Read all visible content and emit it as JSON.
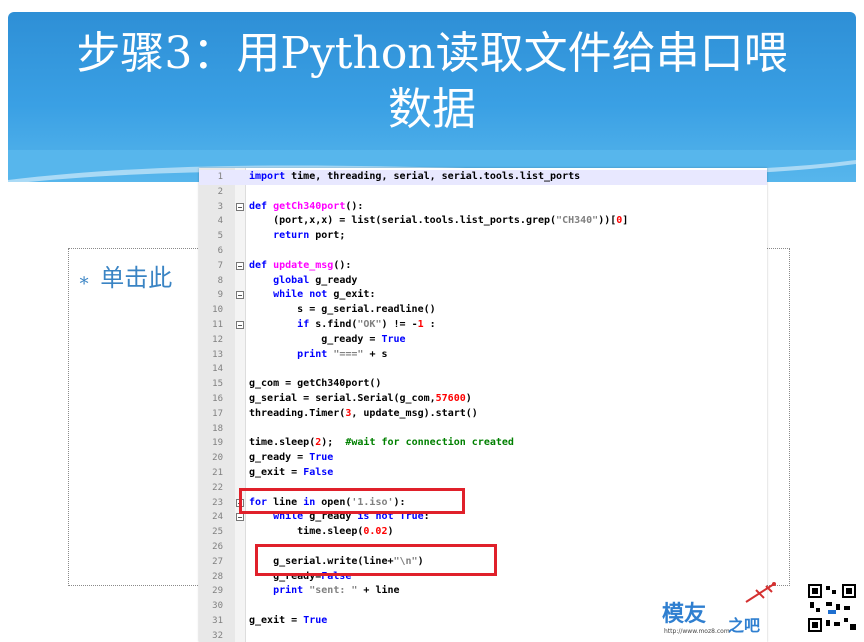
{
  "slide": {
    "title_line1": "步骤3：用Python读取文件给串口喂",
    "title_line2": "数据",
    "placeholder_text": "单击此"
  },
  "editor": {
    "lines": [
      {
        "n": "1",
        "code": "import time, threading, serial, serial.tools.list_ports"
      },
      {
        "n": "2",
        "code": ""
      },
      {
        "n": "3",
        "code": "def getCh340port():"
      },
      {
        "n": "4",
        "code": "    (port,x,x) = list(serial.tools.list_ports.grep(\"CH340\"))[0]"
      },
      {
        "n": "5",
        "code": "    return port;"
      },
      {
        "n": "6",
        "code": ""
      },
      {
        "n": "7",
        "code": "def update_msg():"
      },
      {
        "n": "8",
        "code": "    global g_ready"
      },
      {
        "n": "9",
        "code": "    while not g_exit:"
      },
      {
        "n": "10",
        "code": "        s = g_serial.readline()"
      },
      {
        "n": "11",
        "code": "        if s.find(\"OK\") != -1 :"
      },
      {
        "n": "12",
        "code": "            g_ready = True"
      },
      {
        "n": "13",
        "code": "        print \"===\" + s"
      },
      {
        "n": "14",
        "code": ""
      },
      {
        "n": "15",
        "code": "g_com = getCh340port()"
      },
      {
        "n": "16",
        "code": "g_serial = serial.Serial(g_com,57600)"
      },
      {
        "n": "17",
        "code": "threading.Timer(3, update_msg).start()"
      },
      {
        "n": "18",
        "code": ""
      },
      {
        "n": "19",
        "code": "time.sleep(2);  #wait for connection created"
      },
      {
        "n": "20",
        "code": "g_ready = True"
      },
      {
        "n": "21",
        "code": "g_exit = False"
      },
      {
        "n": "22",
        "code": ""
      },
      {
        "n": "23",
        "code": "for line in open('1.iso'):"
      },
      {
        "n": "24",
        "code": "    while g_ready is not True:"
      },
      {
        "n": "25",
        "code": "        time.sleep(0.02)"
      },
      {
        "n": "26",
        "code": ""
      },
      {
        "n": "27",
        "code": "    g_serial.write(line+\"\\n\")"
      },
      {
        "n": "28",
        "code": "    g_ready=False"
      },
      {
        "n": "29",
        "code": "    print \"sent: \" + line"
      },
      {
        "n": "30",
        "code": ""
      },
      {
        "n": "31",
        "code": "g_exit = True"
      },
      {
        "n": "32",
        "code": ""
      }
    ]
  },
  "watermark": {
    "brand": "模友",
    "suffix": "之吧",
    "url": "http://www.moz8.com"
  },
  "colors": {
    "title_bg": "#3aa0e4",
    "highlight_box": "#e0202a",
    "keyword": "#0000ff",
    "string": "#808080",
    "number": "#ff0000",
    "comment": "#008000"
  }
}
